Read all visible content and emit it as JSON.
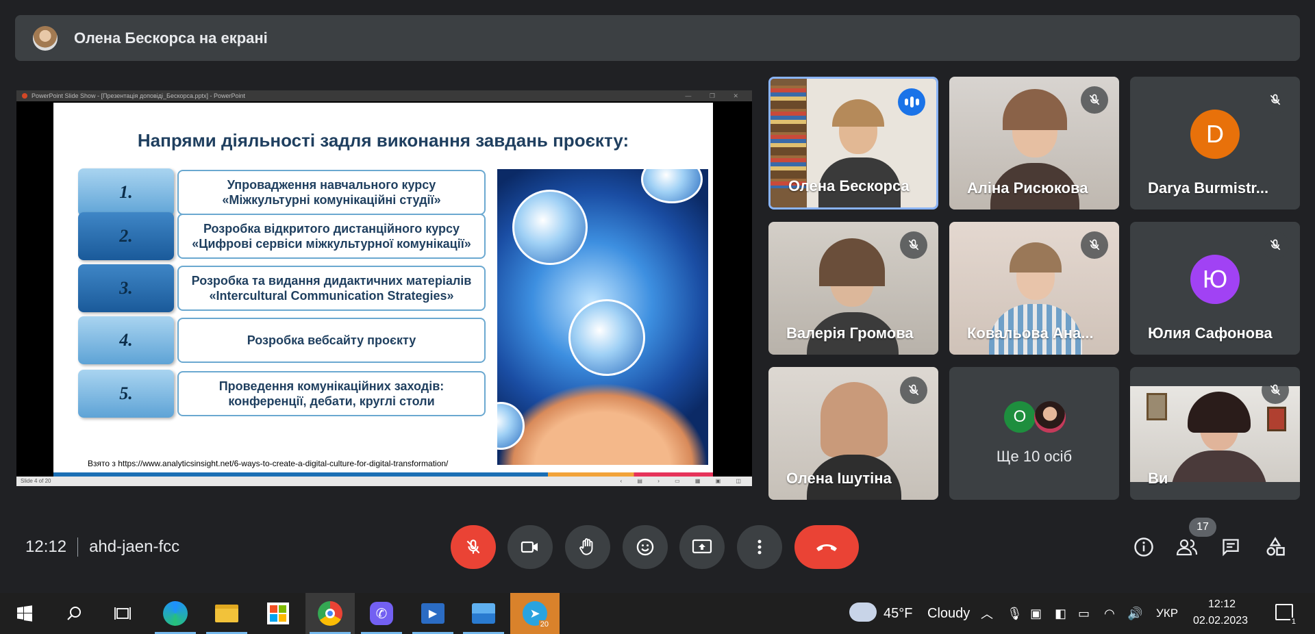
{
  "presenter_banner": {
    "text": "Олена Бескорса на екрані"
  },
  "shared_window": {
    "title": "PowerPoint Slide Show - [Презентація доповіді_Бескорса.pptx] - PowerPoint",
    "status_left": "Slide 4 of 20"
  },
  "slide": {
    "title": "Напрями діяльності задля виконання завдань проєкту:",
    "items": [
      {
        "num": "1.",
        "text": "Упровадження навчального курсу «Міжкультурні комунікаційні студії»"
      },
      {
        "num": "2.",
        "text": "Розробка відкритого дистанційного курсу «Цифрові сервіси міжкультурної комунікації»"
      },
      {
        "num": "3.",
        "text": "Розробка та видання  дидактичних матеріалів «Intercultural Communication Strategies»"
      },
      {
        "num": "4.",
        "text": "Розробка вебсайту проєкту"
      },
      {
        "num": "5.",
        "text": "Проведення комунікаційних заходів: конференції, дебати, круглі столи"
      }
    ],
    "source": "Взято з https://www.analyticsinsight.net/6-ways-to-create-a-digital-culture-for-digital-transformation/"
  },
  "participants": [
    {
      "name": "Олена Бескорса",
      "state": "speaking",
      "video": true
    },
    {
      "name": "Аліна Рисюкова",
      "state": "muted",
      "video": true
    },
    {
      "name": "Darya Burmistr...",
      "state": "muted",
      "video": false,
      "initial": "D",
      "color": "#e8710a"
    },
    {
      "name": "Валерія Громова",
      "state": "muted",
      "video": true
    },
    {
      "name": "Ковальова Ана...",
      "state": "muted",
      "video": true
    },
    {
      "name": "Юлия Сафонова",
      "state": "muted",
      "video": false,
      "initial": "Ю",
      "color": "#a142f4"
    },
    {
      "name": "Олена Ішутіна",
      "state": "muted",
      "video": true
    },
    {
      "name": "Ще 10 осіб",
      "initial": "О",
      "color": "#1e8e3e"
    },
    {
      "name": "Ви",
      "state": "muted",
      "video": true
    }
  ],
  "meeting": {
    "time": "12:12",
    "code": "ahd-jaen-fcc",
    "people_count": "17"
  },
  "colors": {
    "background": "#202124",
    "tile": "#3c4043",
    "accent": "#8ab4f8",
    "danger": "#ea4335"
  },
  "taskbar": {
    "weather_temp": "45°F",
    "weather_text": "Cloudy",
    "language": "УКР",
    "time": "12:12",
    "date": "02.02.2023",
    "telegram_badge": "20",
    "notifications": "1"
  }
}
